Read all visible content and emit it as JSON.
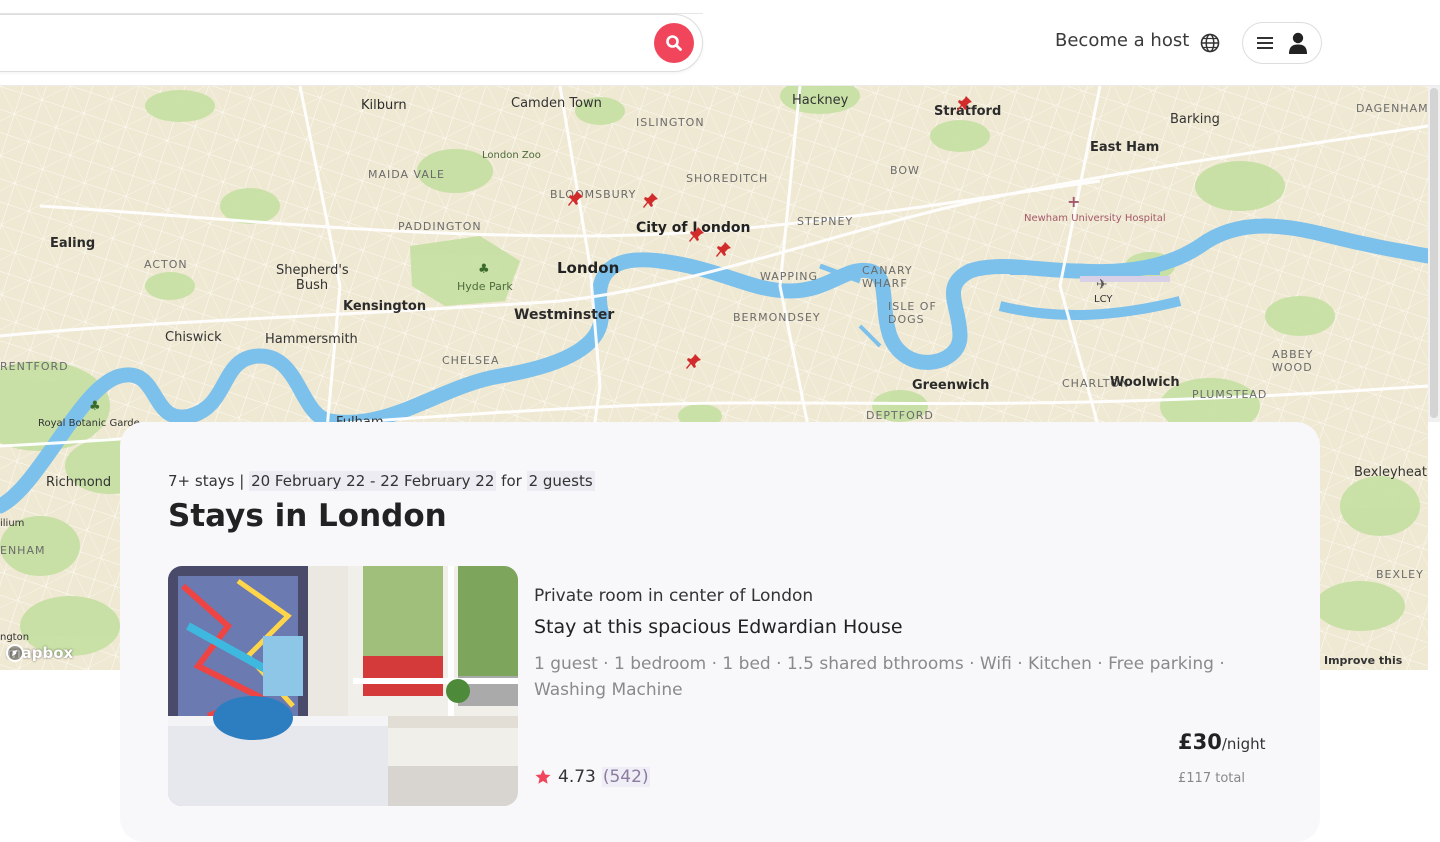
{
  "header": {
    "search_placeholder": "",
    "host_label": "Become a host"
  },
  "map": {
    "labels": {
      "kilburn": "Kilburn",
      "camden": "Camden Town",
      "hackney": "Hackney",
      "stratford": "Stratford",
      "barking": "Barking",
      "dagenham": "DAGENHAM",
      "islington": "ISLINGTON",
      "londonzoo": "London Zoo",
      "maidavale": "MAIDA VALE",
      "shoreditch": "SHOREDITCH",
      "bow": "BOW",
      "eastham": "East Ham",
      "bloomsbury": "BLOOMSBURY",
      "paddington": "PADDINGTON",
      "cityoflondon": "City of London",
      "stepney": "STEPNEY",
      "newham": "Newham University Hospital",
      "ealing": "Ealing",
      "acton": "ACTON",
      "shepherds": "Shepherd's Bush",
      "hydepark": "Hyde Park",
      "london": "London",
      "wapping": "WAPPING",
      "canary": "CANARY WHARF",
      "lcy": "LCY",
      "kensington": "Kensington",
      "westminster": "Westminster",
      "bermondsey": "BERMONDSEY",
      "isleofdogs": "ISLE OF DOGS",
      "chiswick": "Chiswick",
      "hammersmith": "Hammersmith",
      "abbeywood": "ABBEY WOOD",
      "brentford": "RENTFORD",
      "chelsea": "CHELSEA",
      "charlton": "CHARLTON",
      "woolwich": "Woolwich",
      "greenwich": "Greenwich",
      "plumstead": "PLUMSTEAD",
      "kew": "Royal Botanic Garde",
      "fulham": "Fulham",
      "deptford": "DEPTFORD",
      "richmond": "Richmond",
      "bexleyheath": "Bexleyheath",
      "ilium": "ilium",
      "bexley": "BEXLEY",
      "enham": "ENHAM",
      "ngton": "ngton"
    },
    "logo": "mapbox",
    "improve": "Improve this map"
  },
  "results": {
    "count": "7+ stays |",
    "dates": "20 February 22 - 22 February 22",
    "for": "for",
    "guests": "2 guests",
    "title": "Stays in London"
  },
  "listing": {
    "type": "Private room in center of London",
    "name": "Stay at this spacious Edwardian House",
    "amenities": "1 guest · 1 bedroom · 1 bed · 1.5 shared bthrooms · Wifi · Kitchen · Free parking · Washing Machine",
    "rating": "4.73",
    "reviews": "(542)",
    "price": "£30",
    "price_unit": "/night",
    "total": "£117 total"
  },
  "colors": {
    "accent": "#f0455a",
    "water": "#7cc0ec",
    "land": "#efe8d2",
    "park": "#c6e0a4"
  },
  "icons": {
    "search": "search-icon",
    "globe": "globe-icon",
    "menu": "menu-icon",
    "user": "user-icon",
    "pin": "map-pin-icon",
    "star": "star-icon"
  }
}
